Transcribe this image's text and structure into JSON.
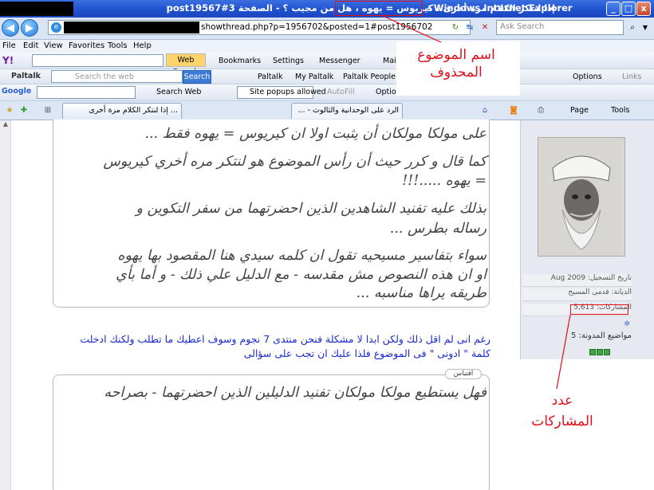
{
  "window": {
    "title_arabic": "إذا لنتكر الكلام مرة أخرى ، كيريوس = يهوه ، هل من مجيب ؟ - الصفحة 3",
    "title_post": "#post19567",
    "title_app": "- Windows Internet Explorer",
    "buttons": {
      "minimize": "_",
      "maximize": "□",
      "close": "x"
    }
  },
  "addressbar": {
    "url_visible": "showthread.php?p=1956702&posted=1#post1956702",
    "search_placeholder": "Ask Search",
    "back_icon": "◀",
    "forward_icon": "▶"
  },
  "menu": {
    "items": [
      "File",
      "Edit",
      "View",
      "Favorites",
      "Tools",
      "Help"
    ]
  },
  "yahoo_toolbar": {
    "logo": "Y!",
    "web_search_label": "Web Search",
    "bookmarks_label": "Bookmarks",
    "settings_label": "Settings",
    "messenger_label": "Messenger",
    "mail_label": "Mail"
  },
  "paltalk_toolbar": {
    "logo_label": "Paltalk",
    "search_placeholder": "Search the web",
    "search_button": "Search",
    "paltalk_label": "Paltalk",
    "my_paltalk_label": "My Paltalk",
    "people_label": "Paltalk People",
    "options_label": "Options",
    "links_label": "Links"
  },
  "google_toolbar": {
    "logo_label": "Google",
    "search_web_label": "Search Web",
    "popups_label": "Site popups allowed",
    "autofill_label": "AutoFill",
    "options_label": "Options"
  },
  "tabs": [
    {
      "label": "... إذا لنتكر الكلام مرة أخرى"
    },
    {
      "label": "الرد على الوحدانية والثالوث - ..."
    }
  ],
  "command_bar": {
    "page_label": "Page",
    "tools_label": "Tools"
  },
  "post": {
    "lines": [
      "على مولكا مولكان أن يثبت اولا ان كيريوس = يهوه فقط ...",
      "كما قال و كرر حيث أن رأس الموضوع هو لنتكر مره أخري كيريوس",
      "= يهوه .....!!!",
      "بذلك عليه تفنيد الشاهدين الذين احضرتهما من سفر التكوين و",
      "رساله بطرس ...",
      "سواء بتفاسير مسيحيه تقول ان كلمه سيدي هنا المقصود بها يهوه",
      "او ان هذه النصوص مش مقدسه - مع الدليل علي ذلك - و أما بأي",
      "طريقه يراها مناسبه ..."
    ]
  },
  "blue_text": {
    "line1": "رغم انى لم اقل ذلك ولكن ابدا لا مشكلة فنحن منتدى 7 نجوم وسوف اعطيك ما تطلب ولكنك ادخلت",
    "line2": "كلمة \" ادونى \" فى الموضوع فلذا عليك ان تجب على سؤالى"
  },
  "quote": {
    "label": "اقتباس",
    "line1": "فهل يستطيع مولكا مولكان تفنيد الدليلين الذين احضرتهما - بصراحه"
  },
  "sidebar": {
    "join_date": "تاريخ التسجيل: Aug 2009",
    "religion": "الديانة: قدمى المسيح",
    "posts_count": "المشاركات: 5,613",
    "blog_entries": "مواضيع المدونة: 5"
  },
  "annotations": {
    "deleted_topic_label_1": "اسم الموضوع",
    "deleted_topic_label_2": "المحذوف",
    "posts_label_1": "عدد",
    "posts_label_2": "المشاركات",
    "color": "#e0101a"
  }
}
